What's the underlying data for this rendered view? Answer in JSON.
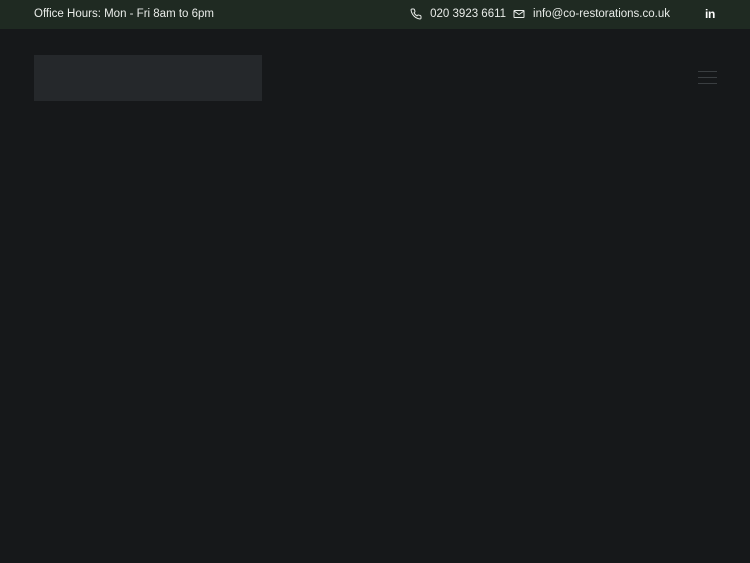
{
  "topbar": {
    "office_hours": "Office Hours: Mon - Fri 8am to 6pm",
    "phone": "020 3923 6611",
    "email": "info@co-restorations.co.uk",
    "phone_icon": "phone-icon",
    "email_icon": "envelope-icon",
    "social_icon": "linkedin-icon",
    "social_label": "in"
  },
  "header": {
    "menu_icon": "hamburger-menu-icon"
  },
  "colors": {
    "topbar_bg": "#1f2a22",
    "page_bg": "#16181a",
    "logo_placeholder_bg": "#25282b",
    "text": "#e9ece9"
  }
}
